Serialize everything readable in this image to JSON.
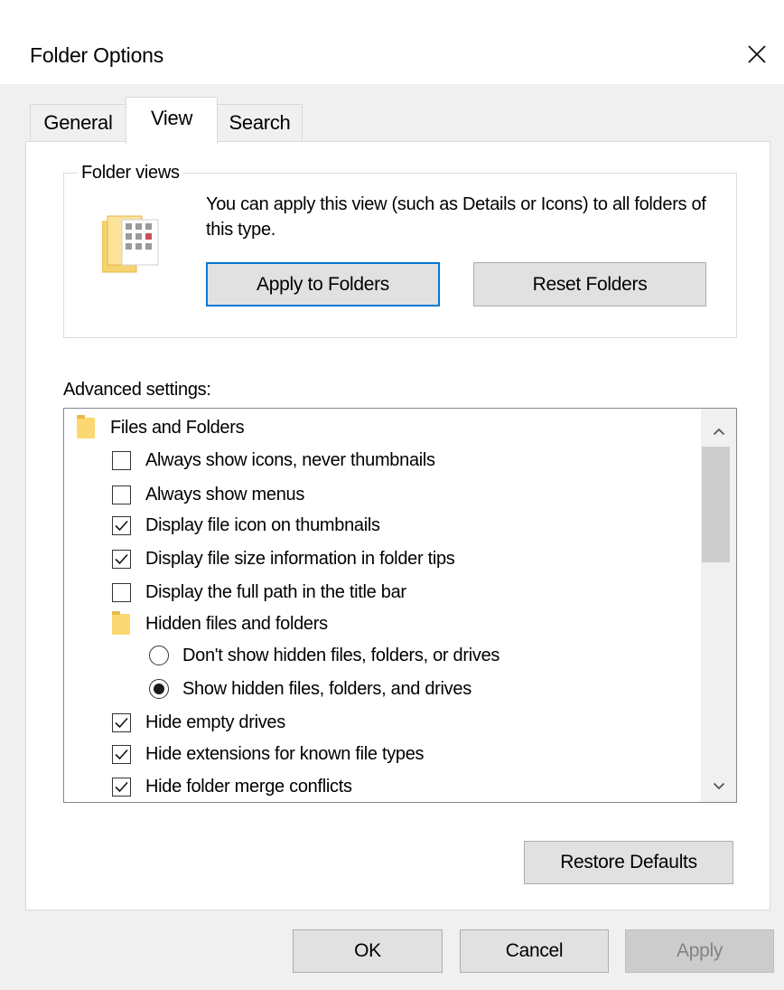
{
  "dialog": {
    "title": "Folder Options",
    "tabs": [
      {
        "label": "General",
        "selected": false
      },
      {
        "label": "View",
        "selected": true
      },
      {
        "label": "Search",
        "selected": false
      }
    ]
  },
  "folder_views": {
    "group_label": "Folder views",
    "description": "You can apply this view (such as Details or Icons) to all folders of this type.",
    "apply_button": "Apply to Folders",
    "reset_button": "Reset Folders"
  },
  "advanced": {
    "label": "Advanced settings:",
    "items": [
      {
        "type": "folder",
        "label": "Files and Folders",
        "level": 0
      },
      {
        "type": "checkbox",
        "label": "Always show icons, never thumbnails",
        "checked": false,
        "level": 1
      },
      {
        "type": "checkbox",
        "label": "Always show menus",
        "checked": false,
        "level": 1
      },
      {
        "type": "checkbox",
        "label": "Display file icon on thumbnails",
        "checked": true,
        "level": 1
      },
      {
        "type": "checkbox",
        "label": "Display file size information in folder tips",
        "checked": true,
        "level": 1
      },
      {
        "type": "checkbox",
        "label": "Display the full path in the title bar",
        "checked": false,
        "level": 1
      },
      {
        "type": "folder",
        "label": "Hidden files and folders",
        "level": 1
      },
      {
        "type": "radio",
        "label": "Don't show hidden files, folders, or drives",
        "selected": false,
        "level": 2
      },
      {
        "type": "radio",
        "label": "Show hidden files, folders, and drives",
        "selected": true,
        "level": 2
      },
      {
        "type": "checkbox",
        "label": "Hide empty drives",
        "checked": true,
        "level": 1
      },
      {
        "type": "checkbox",
        "label": "Hide extensions for known file types",
        "checked": true,
        "level": 1
      },
      {
        "type": "checkbox",
        "label": "Hide folder merge conflicts",
        "checked": true,
        "level": 1
      }
    ],
    "restore_button": "Restore Defaults"
  },
  "footer": {
    "ok": "OK",
    "cancel": "Cancel",
    "apply": "Apply",
    "apply_enabled": false
  },
  "colors": {
    "window_bg": "#f0f0f0",
    "panel_bg": "#ffffff",
    "focus_blue": "#0078d7",
    "folder_yellow": "#fcd872"
  },
  "icons": {
    "close": "close-icon",
    "folder_view": "folder-view-icon",
    "folder": "folder-icon",
    "scroll_up": "chevron-up-icon",
    "scroll_down": "chevron-down-icon"
  }
}
